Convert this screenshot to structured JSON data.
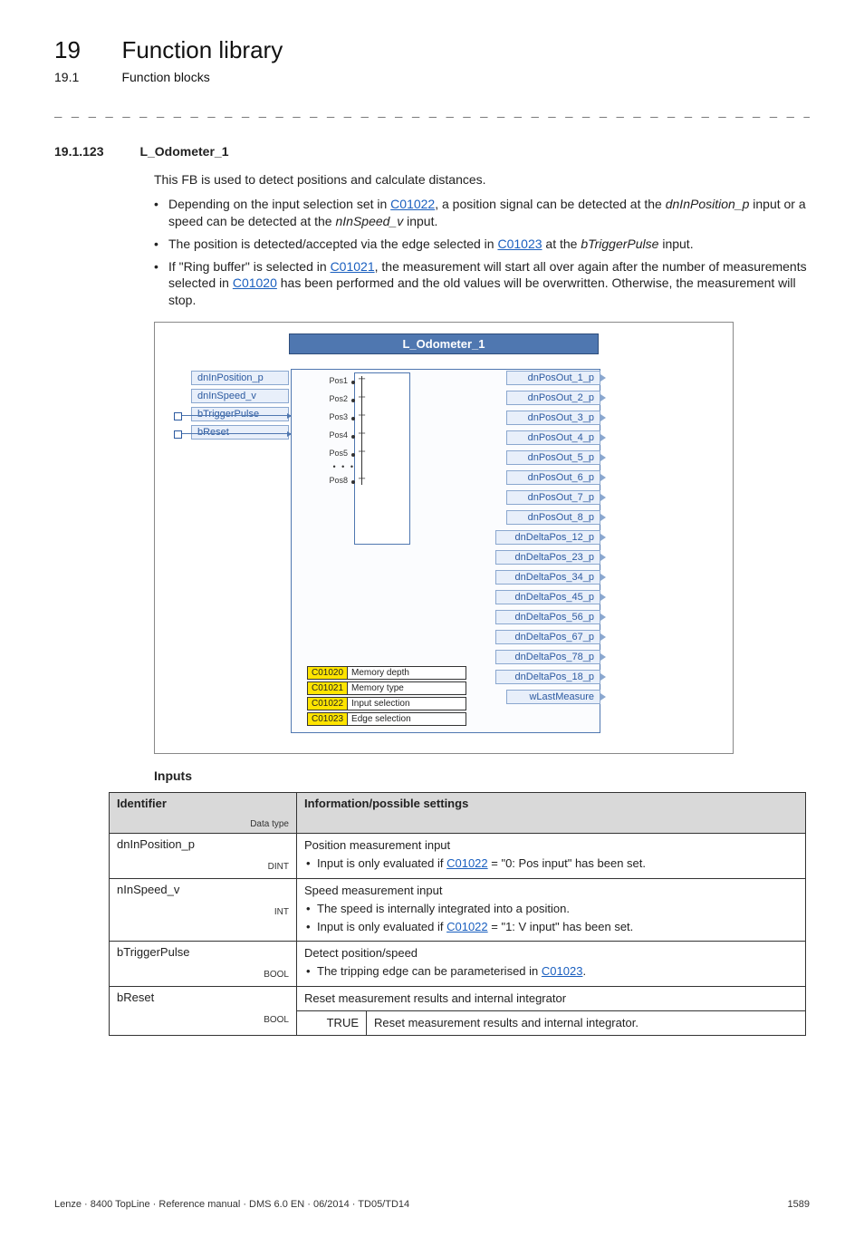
{
  "header": {
    "chapter_no": "19",
    "chapter_title": "Function library",
    "section_no": "19.1",
    "section_title": "Function blocks"
  },
  "separator": "_ _ _ _ _ _ _ _ _ _ _ _ _ _ _ _ _ _ _ _ _ _ _ _ _ _ _ _ _ _ _ _ _ _ _ _ _ _ _ _ _ _ _ _ _ _ _ _ _ _ _ _ _ _ _ _ _ _ _ _ _ _ _ _",
  "subhead": {
    "no": "19.1.123",
    "title": "L_Odometer_1"
  },
  "intro": "This FB is used to detect positions and calculate distances.",
  "bullets": {
    "b1a": "Depending on the input selection set in ",
    "b1_link": "C01022",
    "b1b": ", a position signal can be detected at the ",
    "b1_i1": "dnInPosition_p",
    "b1c": " input or a speed can be detected at the ",
    "b1_i2": "nInSpeed_v",
    "b1d": " input.",
    "b2a": "The position is detected/accepted via the edge selected in ",
    "b2_link": "C01023",
    "b2b": " at the ",
    "b2_i": "bTriggerPulse",
    "b2c": " input.",
    "b3a": "If \"Ring buffer\" is selected in ",
    "b3_link1": "C01021",
    "b3b": ", the measurement will start all over again after the number of measurements selected in ",
    "b3_link2": "C01020",
    "b3c": " has been performed and the old values will be overwritten. Otherwise, the measurement will stop."
  },
  "diagram": {
    "title": "L_Odometer_1",
    "inputs": [
      "dnInPosition_p",
      "dnInSpeed_v",
      "bTriggerPulse",
      "bReset"
    ],
    "pos": [
      "Pos1",
      "Pos2",
      "Pos3",
      "Pos4",
      "Pos5",
      "• • •",
      "Pos8"
    ],
    "params": [
      {
        "code": "C01020",
        "text": "Memory depth"
      },
      {
        "code": "C01021",
        "text": "Memory type"
      },
      {
        "code": "C01022",
        "text": "Input selection"
      },
      {
        "code": "C01023",
        "text": "Edge selection"
      }
    ],
    "outputs": [
      "dnPosOut_1_p",
      "dnPosOut_2_p",
      "dnPosOut_3_p",
      "dnPosOut_4_p",
      "dnPosOut_5_p",
      "dnPosOut_6_p",
      "dnPosOut_7_p",
      "dnPosOut_8_p",
      "dnDeltaPos_12_p",
      "dnDeltaPos_23_p",
      "dnDeltaPos_34_p",
      "dnDeltaPos_45_p",
      "dnDeltaPos_56_p",
      "dnDeltaPos_67_p",
      "dnDeltaPos_78_p",
      "dnDeltaPos_18_p",
      "wLastMeasure"
    ]
  },
  "inputs_heading": "Inputs",
  "table": {
    "hdr_id": "Identifier",
    "hdr_dtype": "Data type",
    "hdr_info": "Information/possible settings",
    "rows": [
      {
        "id": "dnInPosition_p",
        "dtype": "DINT",
        "line1": "Position measurement input",
        "li1a": "Input is only evaluated if ",
        "li1_link": "C01022",
        "li1b": " = \"0: Pos input\" has been set."
      },
      {
        "id": "nInSpeed_v",
        "dtype": "INT",
        "line1": "Speed measurement input",
        "li1": "The speed is internally integrated into a position.",
        "li2a": "Input is only evaluated if ",
        "li2_link": "C01022",
        "li2b": " = \"1: V input\" has been set."
      },
      {
        "id": "bTriggerPulse",
        "dtype": "BOOL",
        "line1": "Detect position/speed",
        "li1a": "The tripping edge can be parameterised in ",
        "li1_link": "C01023",
        "li1b": "."
      },
      {
        "id": "bReset",
        "dtype": "BOOL",
        "line1": "Reset measurement results and internal integrator",
        "sub_k": "TRUE",
        "sub_v": "Reset measurement results and internal integrator."
      }
    ]
  },
  "footer": {
    "left": "Lenze · 8400 TopLine · Reference manual · DMS 6.0 EN · 06/2014 · TD05/TD14",
    "right": "1589"
  }
}
